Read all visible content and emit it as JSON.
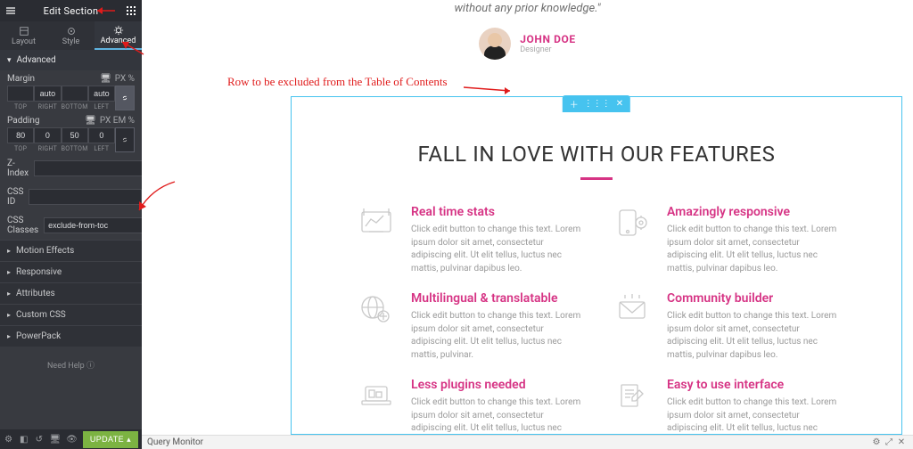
{
  "panel": {
    "title": "Edit Section",
    "tabs": {
      "layout": "Layout",
      "style": "Style",
      "advanced": "Advanced"
    },
    "adv_header": "Advanced",
    "margin": {
      "label": "Margin",
      "units": "PX   %",
      "top": "",
      "right": "auto",
      "bottom": "",
      "left": "auto",
      "lbl_top": "TOP",
      "lbl_right": "RIGHT",
      "lbl_bottom": "BOTTOM",
      "lbl_left": "LEFT"
    },
    "padding": {
      "label": "Padding",
      "units": "PX  EM  %",
      "top": "80",
      "right": "0",
      "bottom": "50",
      "left": "0",
      "lbl_top": "TOP",
      "lbl_right": "RIGHT",
      "lbl_bottom": "BOTTOM",
      "lbl_left": "LEFT"
    },
    "zindex_label": "Z-Index",
    "cssid_label": "CSS ID",
    "cssclasses_label": "CSS Classes",
    "cssclasses_value": "exclude-from-toc",
    "sections": {
      "motion": "Motion Effects",
      "responsive": "Responsive",
      "attributes": "Attributes",
      "customcss": "Custom CSS",
      "powerpack": "PowerPack"
    },
    "need_help": "Need Help",
    "update": "UPDATE"
  },
  "annotations": {
    "row_exclude": "Row to be excluded from the Table of Contents"
  },
  "preview": {
    "quote": "without any prior knowledge.\"",
    "author": {
      "name": "JOHN DOE",
      "role": "Designer"
    },
    "heading": "FALL IN LOVE WITH OUR FEATURES",
    "lorem": "Click edit button to change this text. Lorem ipsum dolor sit amet, consectetur adipiscing elit. Ut elit tellus, luctus nec mattis, pulvinar dapibus leo.",
    "lorem_short": "Click edit button to change this text. Lorem ipsum dolor sit amet, consectetur adipiscing elit. Ut elit tellus, luctus nec mattis, pulvinar.",
    "features": {
      "f1": "Real time stats",
      "f2": "Amazingly responsive",
      "f3": "Multilingual & translatable",
      "f4": "Community builder",
      "f5": "Less plugins needed",
      "f6": "Easy to use interface"
    }
  },
  "bottom": {
    "query_monitor": "Query Monitor"
  }
}
